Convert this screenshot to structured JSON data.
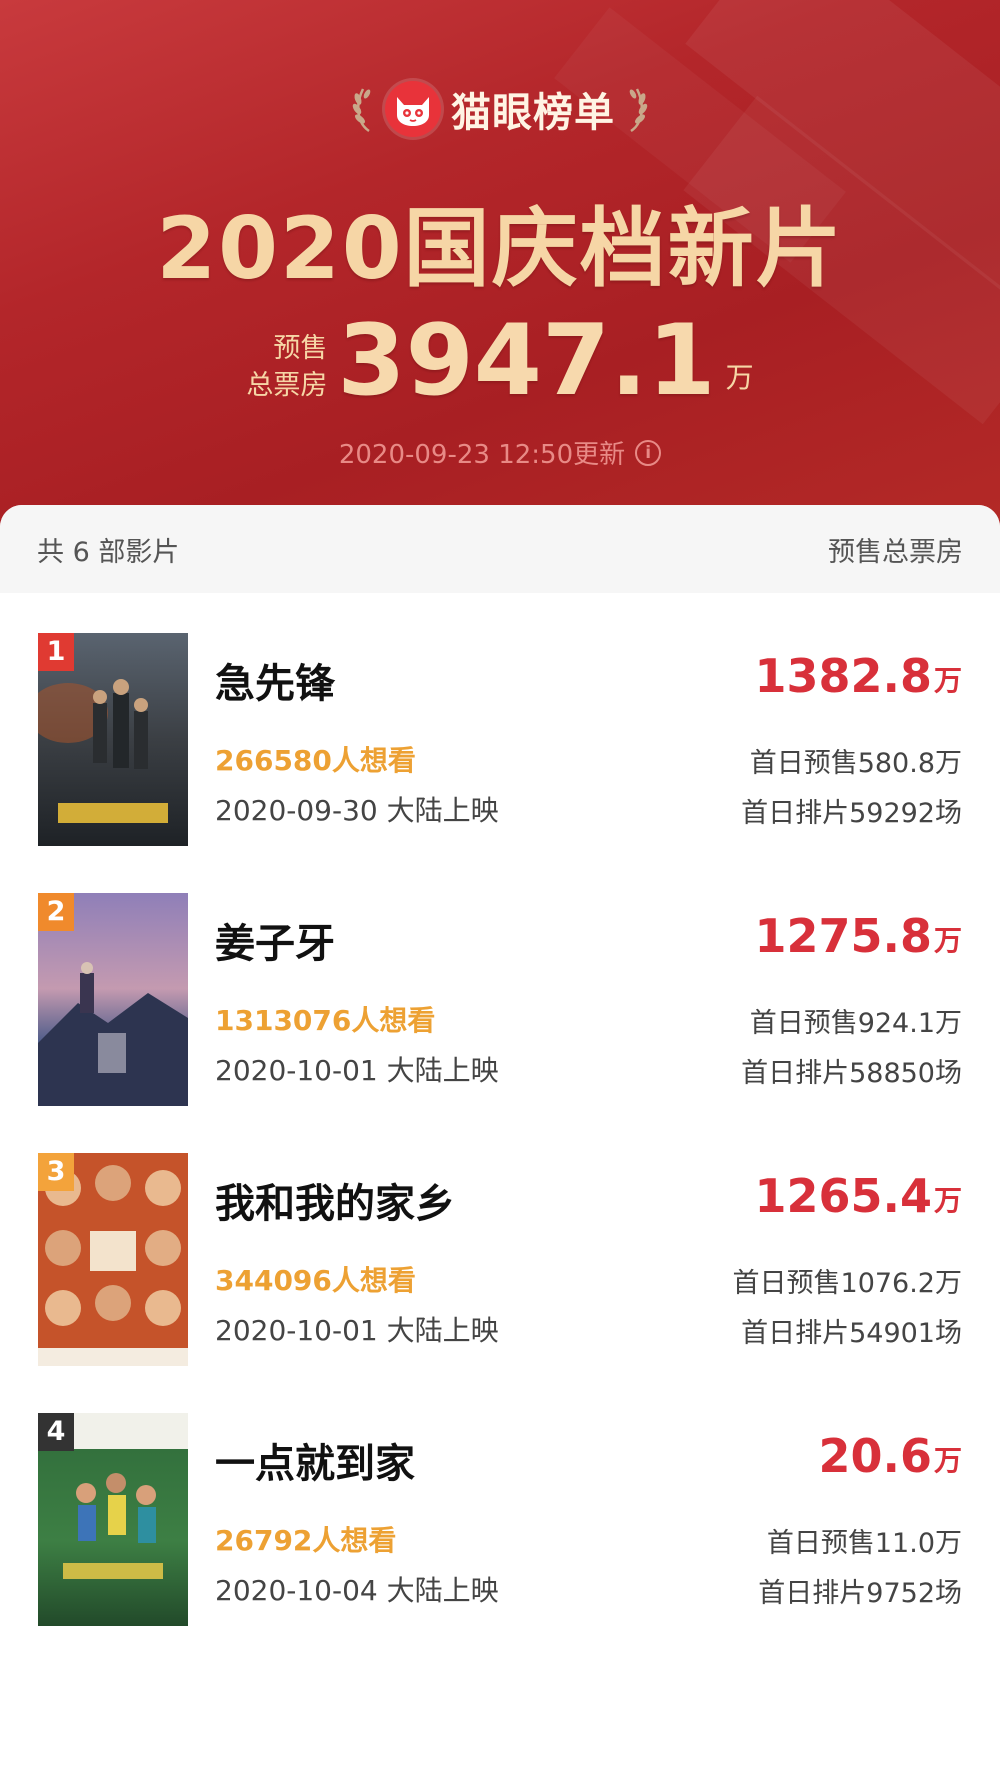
{
  "header": {
    "brand_name": "猫眼榜单",
    "title": "2020国庆档新片",
    "total_label_line1": "预售",
    "total_label_line2": "总票房",
    "total_value": "3947.1",
    "total_unit": "万",
    "update_text": "2020-09-23 12:50更新",
    "info_icon": "i"
  },
  "list": {
    "count_text": "共 6 部影片",
    "column_title": "预售总票房",
    "movies": [
      {
        "rank": "1",
        "title": "急先锋",
        "want": "266580人想看",
        "release": "2020-09-30 大陆上映",
        "box": "1382.8",
        "unit": "万",
        "presale": "首日预售580.8万",
        "shows": "首日排片59292场",
        "rank_color": "#e03a32"
      },
      {
        "rank": "2",
        "title": "姜子牙",
        "want": "1313076人想看",
        "release": "2020-10-01 大陆上映",
        "box": "1275.8",
        "unit": "万",
        "presale": "首日预售924.1万",
        "shows": "首日排片58850场",
        "rank_color": "#f08a2c"
      },
      {
        "rank": "3",
        "title": "我和我的家乡",
        "want": "344096人想看",
        "release": "2020-10-01 大陆上映",
        "box": "1265.4",
        "unit": "万",
        "presale": "首日预售1076.2万",
        "shows": "首日排片54901场",
        "rank_color": "#f3a33b"
      },
      {
        "rank": "4",
        "title": "一点就到家",
        "want": "26792人想看",
        "release": "2020-10-04 大陆上映",
        "box": "20.6",
        "unit": "万",
        "presale": "首日预售11.0万",
        "shows": "首日排片9752场",
        "rank_color": "#333333"
      }
    ]
  },
  "colors": {
    "header_red": "#b3262a",
    "gold": "#f6d6a6",
    "box_red": "#d8303a",
    "want_orange": "#eda133"
  }
}
